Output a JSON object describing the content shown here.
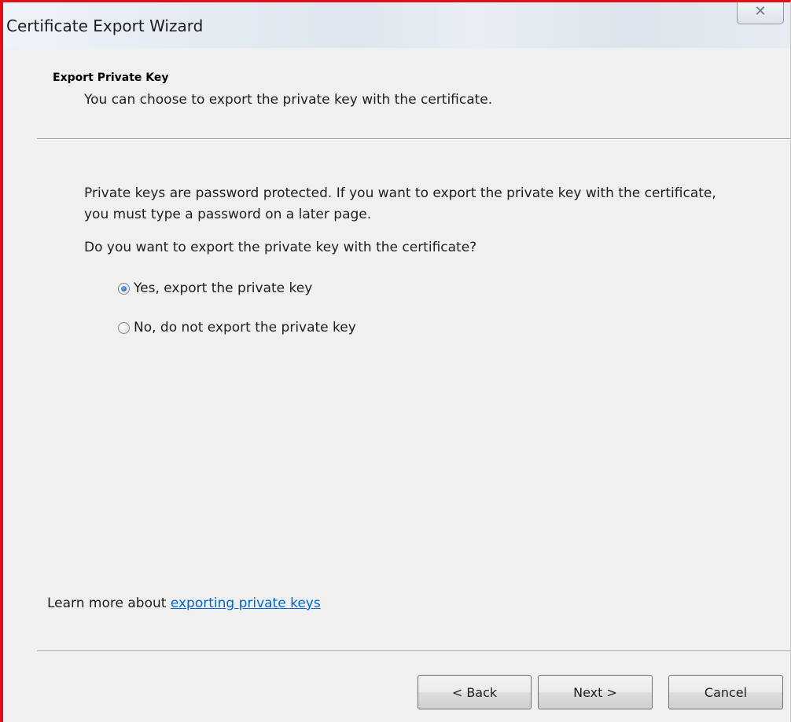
{
  "window": {
    "title": "Certificate Export Wizard",
    "close_glyph": "✕"
  },
  "header": {
    "title": "Export Private Key",
    "subtitle": "You can choose to export the private key with the certificate."
  },
  "body": {
    "paragraph": "Private keys are password protected. If you want to export the private key with the certificate, you must type a password on a later page.",
    "question": "Do you want to export the private key with the certificate?",
    "options": [
      {
        "label": "Yes, export the private key",
        "checked": true
      },
      {
        "label": "No, do not export the private key",
        "checked": false
      }
    ]
  },
  "learn_more": {
    "prefix": "Learn more about ",
    "link_text": "exporting private keys"
  },
  "buttons": {
    "back": "< Back",
    "next": "Next >",
    "cancel": "Cancel"
  },
  "colors": {
    "accent_border": "#e0101a",
    "link": "#0066cc"
  }
}
